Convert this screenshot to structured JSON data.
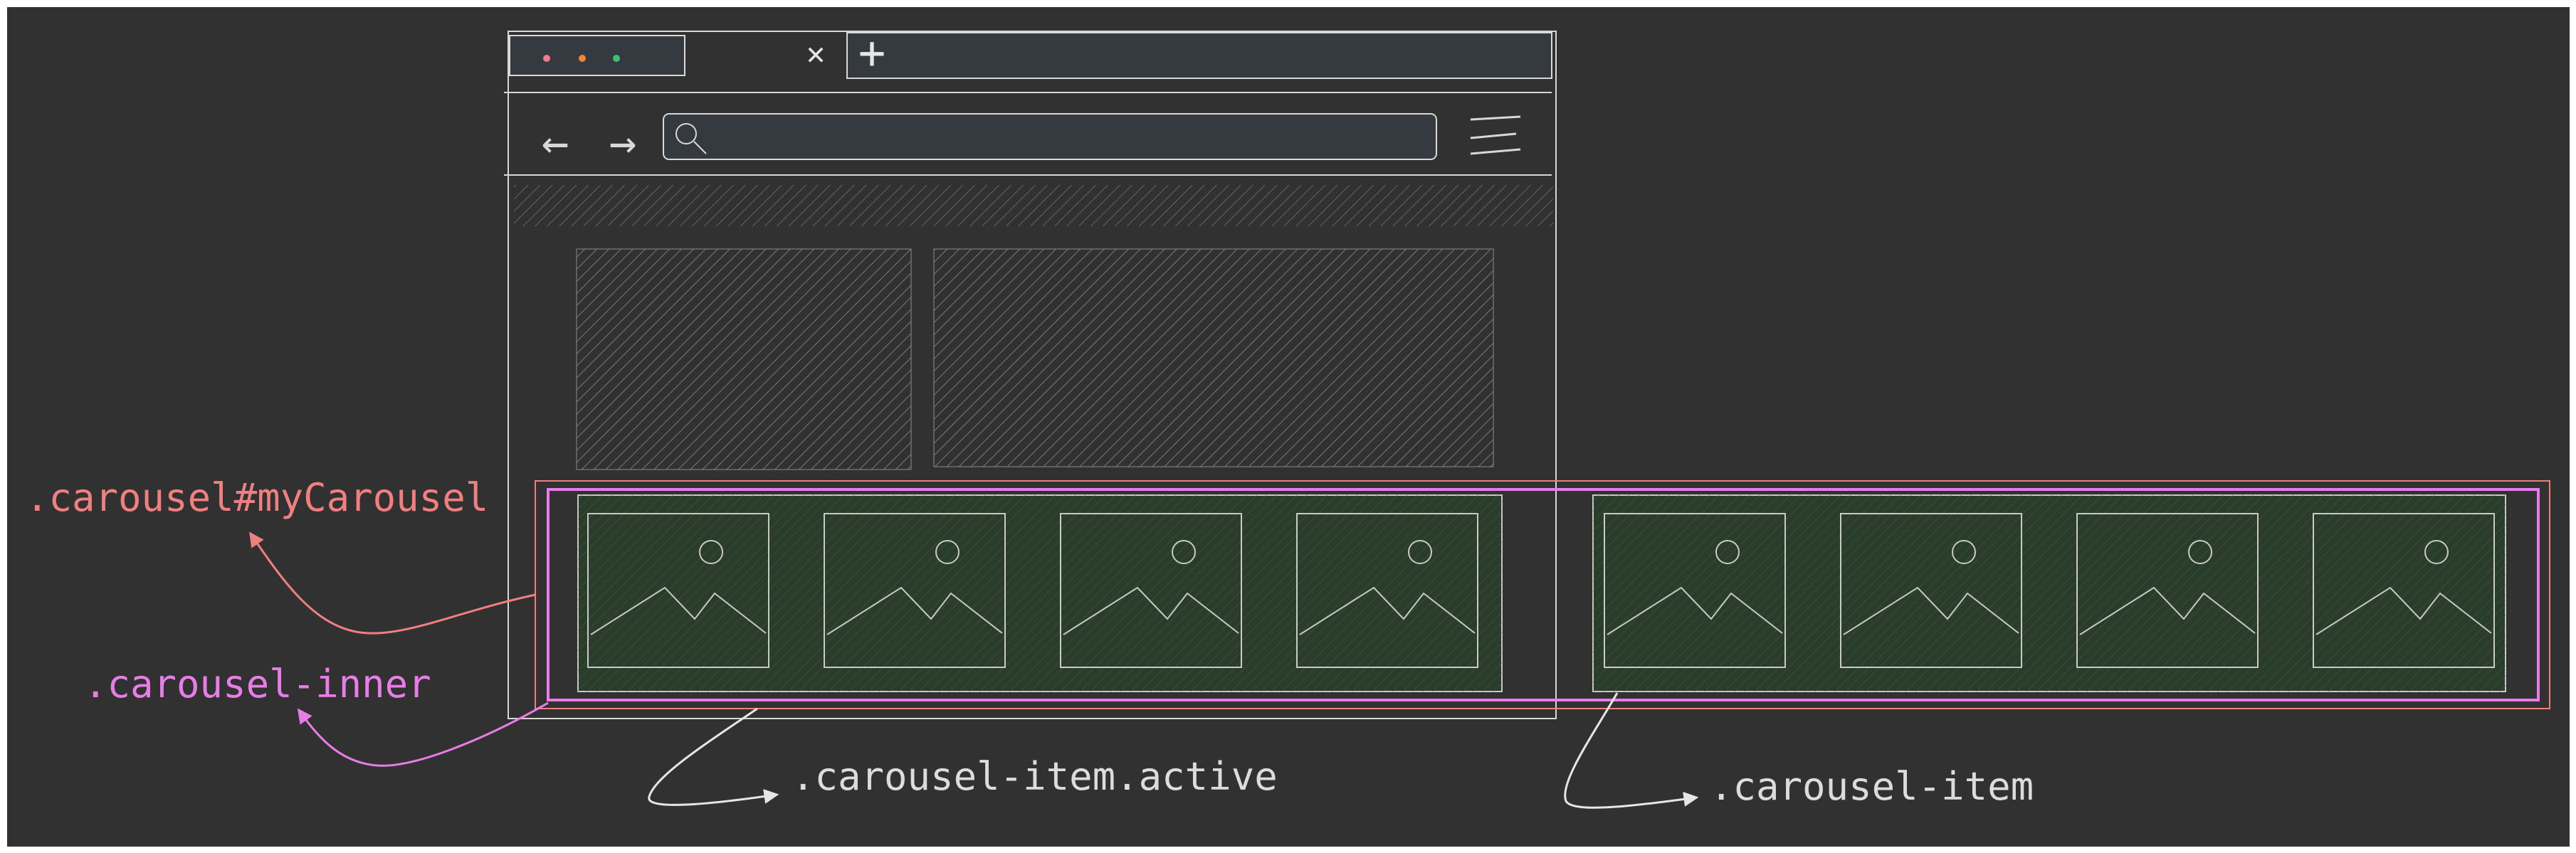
{
  "colors": {
    "background": "#313131",
    "line": "#d8d8d8",
    "browser_fill": "#343a40",
    "hatch": "#6e6e6e",
    "item_fill": "#2a3d2a",
    "item_stroke": "#c9c9c9",
    "carousel": "#f08080",
    "inner": "#e87de8",
    "label_text": "#dcdcdc",
    "dot_red": "#f47a8a",
    "dot_orange": "#e8883a",
    "dot_green": "#3fbf6f"
  },
  "browser": {
    "close_glyph": "✕",
    "new_tab_glyph": "+",
    "back_glyph": "←",
    "forward_glyph": "→",
    "search_glyph": "⌕",
    "menu_glyph": "≡"
  },
  "labels": {
    "carousel": ".carousel#myCarousel",
    "inner": ".carousel-inner",
    "active_item": ".carousel-item.active",
    "item": ".carousel-item"
  },
  "image_icon": "image-placeholder-icon"
}
